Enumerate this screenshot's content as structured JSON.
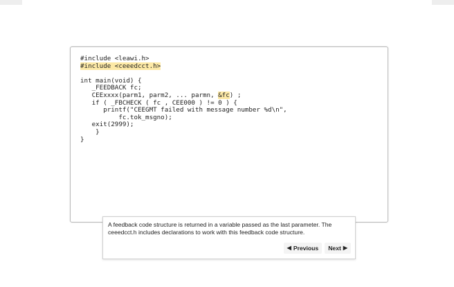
{
  "code": {
    "lines": [
      {
        "pre": "#include <leawi.h>",
        "hl": "",
        "post": ""
      },
      {
        "pre": "",
        "hl": "#include <ceeedcct.h>",
        "post": ""
      },
      {
        "pre": "",
        "hl": "",
        "post": ""
      },
      {
        "pre": "int main(void) {",
        "hl": "",
        "post": ""
      },
      {
        "pre": "   _FEEDBACK fc;",
        "hl": "",
        "post": ""
      },
      {
        "pre": "   CEExxxx(parm1, parm2, ... parmn, ",
        "hl": "&fc",
        "post": ") ;"
      },
      {
        "pre": "   if ( _FBCHECK ( fc , CEE000 ) != 0 ) {",
        "hl": "",
        "post": ""
      },
      {
        "pre": "      printf(\"CEEGMT failed with message number %d\\n\",",
        "hl": "",
        "post": ""
      },
      {
        "pre": "          fc.tok_msgno);",
        "hl": "",
        "post": ""
      },
      {
        "pre": "   exit(2999);",
        "hl": "",
        "post": ""
      },
      {
        "pre": "    }",
        "hl": "",
        "post": ""
      },
      {
        "pre": "}",
        "hl": "",
        "post": ""
      }
    ]
  },
  "tip": {
    "text": "A feedback code structure is returned in a variable passed as the last parameter. The ceeedcct.h includes declarations to work with this feedback code structure.",
    "prev_label": "Previous",
    "next_label": "Next",
    "prev_arrow": "◀",
    "next_arrow": "▶"
  },
  "colors": {
    "highlight": "#fde9a6",
    "panel_border": "#b9b9b9"
  }
}
